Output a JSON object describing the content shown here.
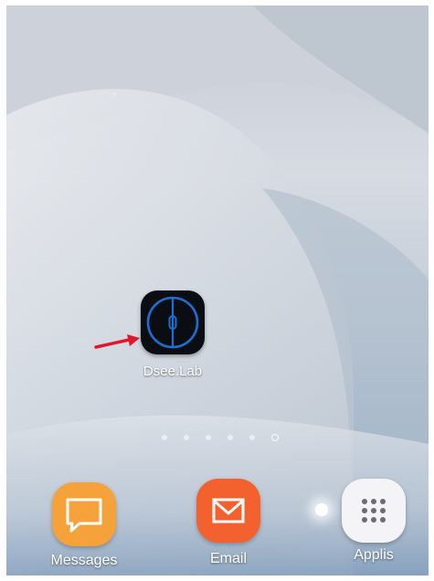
{
  "home": {
    "app": {
      "label": "Dsee.Lab",
      "icon": "compass-app-icon"
    }
  },
  "page_indicator": {
    "count": 6,
    "current": 6
  },
  "dock": {
    "messages": {
      "label": "Messages",
      "icon": "chat-bubble-icon",
      "color": "#F5A23A"
    },
    "email": {
      "label": "Email",
      "icon": "envelope-icon",
      "color": "#F2612E"
    },
    "apps": {
      "label": "Applis",
      "icon": "apps-grid-icon",
      "color": "#F4F4F6"
    }
  },
  "annotation": {
    "arrow_color": "#E0182D"
  }
}
